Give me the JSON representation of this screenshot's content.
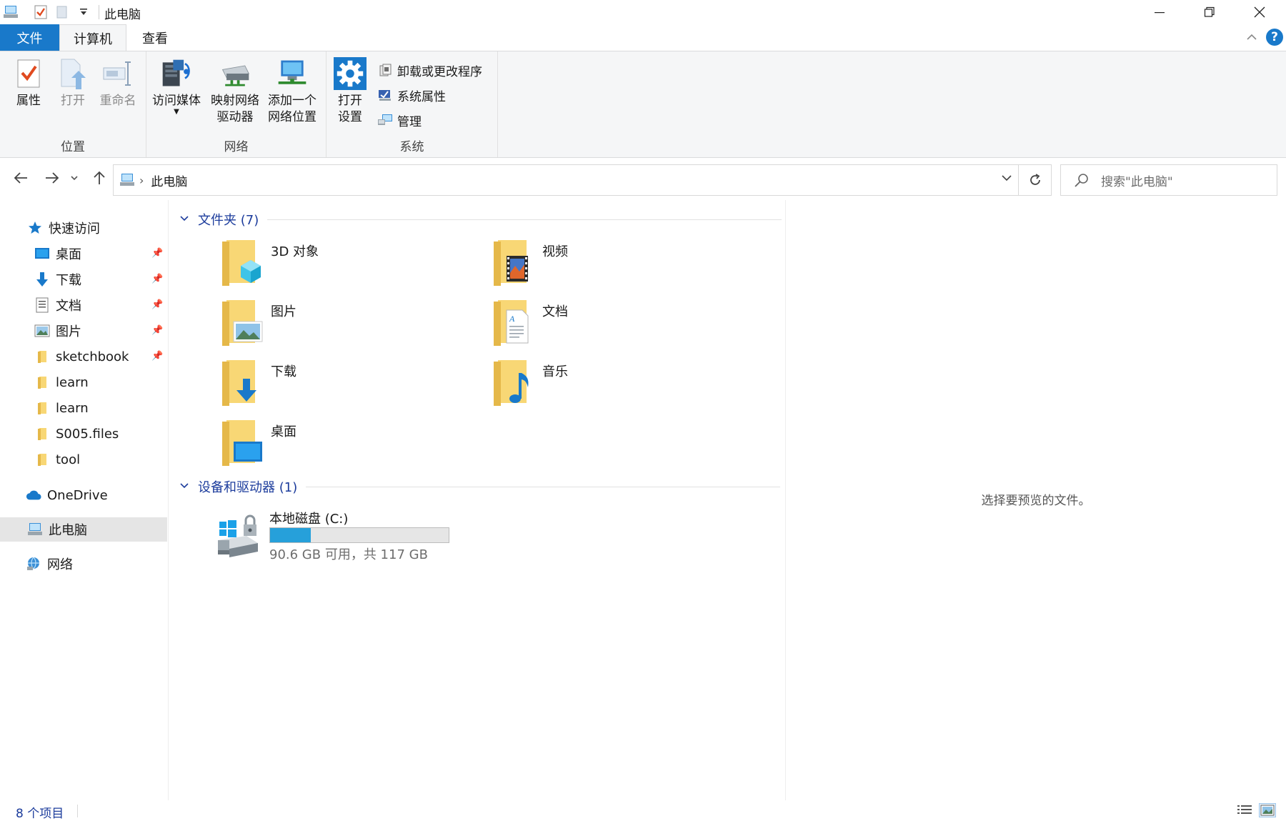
{
  "window": {
    "title": "此电脑",
    "minimize_label": "—",
    "restore_label": "❐",
    "close_label": "✕"
  },
  "tabs": {
    "file": "文件",
    "computer": "计算机",
    "view": "查看",
    "help": "?"
  },
  "ribbon": {
    "location": {
      "label": "位置",
      "properties": "属性",
      "open": "打开",
      "rename": "重命名"
    },
    "network": {
      "label": "网络",
      "access_media": "访问媒体",
      "map_drive_line1": "映射网络",
      "map_drive_line2": "驱动器",
      "add_location_line1": "添加一个",
      "add_location_line2": "网络位置"
    },
    "system": {
      "label": "系统",
      "open_settings_line1": "打开",
      "open_settings_line2": "设置",
      "uninstall": "卸载或更改程序",
      "system_properties": "系统属性",
      "manage": "管理"
    }
  },
  "address": {
    "crumb": "此电脑",
    "search_placeholder": "搜索\"此电脑\""
  },
  "nav": {
    "quick_access": "快速访问",
    "pinned": [
      {
        "label": "桌面"
      },
      {
        "label": "下载"
      },
      {
        "label": "文档"
      },
      {
        "label": "图片"
      },
      {
        "label": "sketchbook"
      }
    ],
    "recent": [
      {
        "label": "learn"
      },
      {
        "label": "learn"
      },
      {
        "label": "S005.files"
      },
      {
        "label": "tool"
      }
    ],
    "onedrive": "OneDrive",
    "this_pc": "此电脑",
    "network": "网络"
  },
  "content": {
    "folders_header": "文件夹 (7)",
    "folders": [
      {
        "name": "3D 对象",
        "icon": "3d-objects-icon"
      },
      {
        "name": "视频",
        "icon": "videos-icon"
      },
      {
        "name": "图片",
        "icon": "pictures-icon"
      },
      {
        "name": "文档",
        "icon": "documents-icon"
      },
      {
        "name": "下载",
        "icon": "downloads-icon"
      },
      {
        "name": "音乐",
        "icon": "music-icon"
      },
      {
        "name": "桌面",
        "icon": "desktop-icon"
      }
    ],
    "devices_header": "设备和驱动器 (1)",
    "drive": {
      "name": "本地磁盘 (C:)",
      "free_text": "90.6 GB 可用，共 117 GB",
      "used_fraction": 0.226
    }
  },
  "preview": {
    "empty_text": "选择要预览的文件。"
  },
  "status": {
    "item_count": "8 个项目"
  },
  "colors": {
    "accent": "#1979ca",
    "folder": "#f8d775",
    "drive_bar": "#26a0da"
  }
}
